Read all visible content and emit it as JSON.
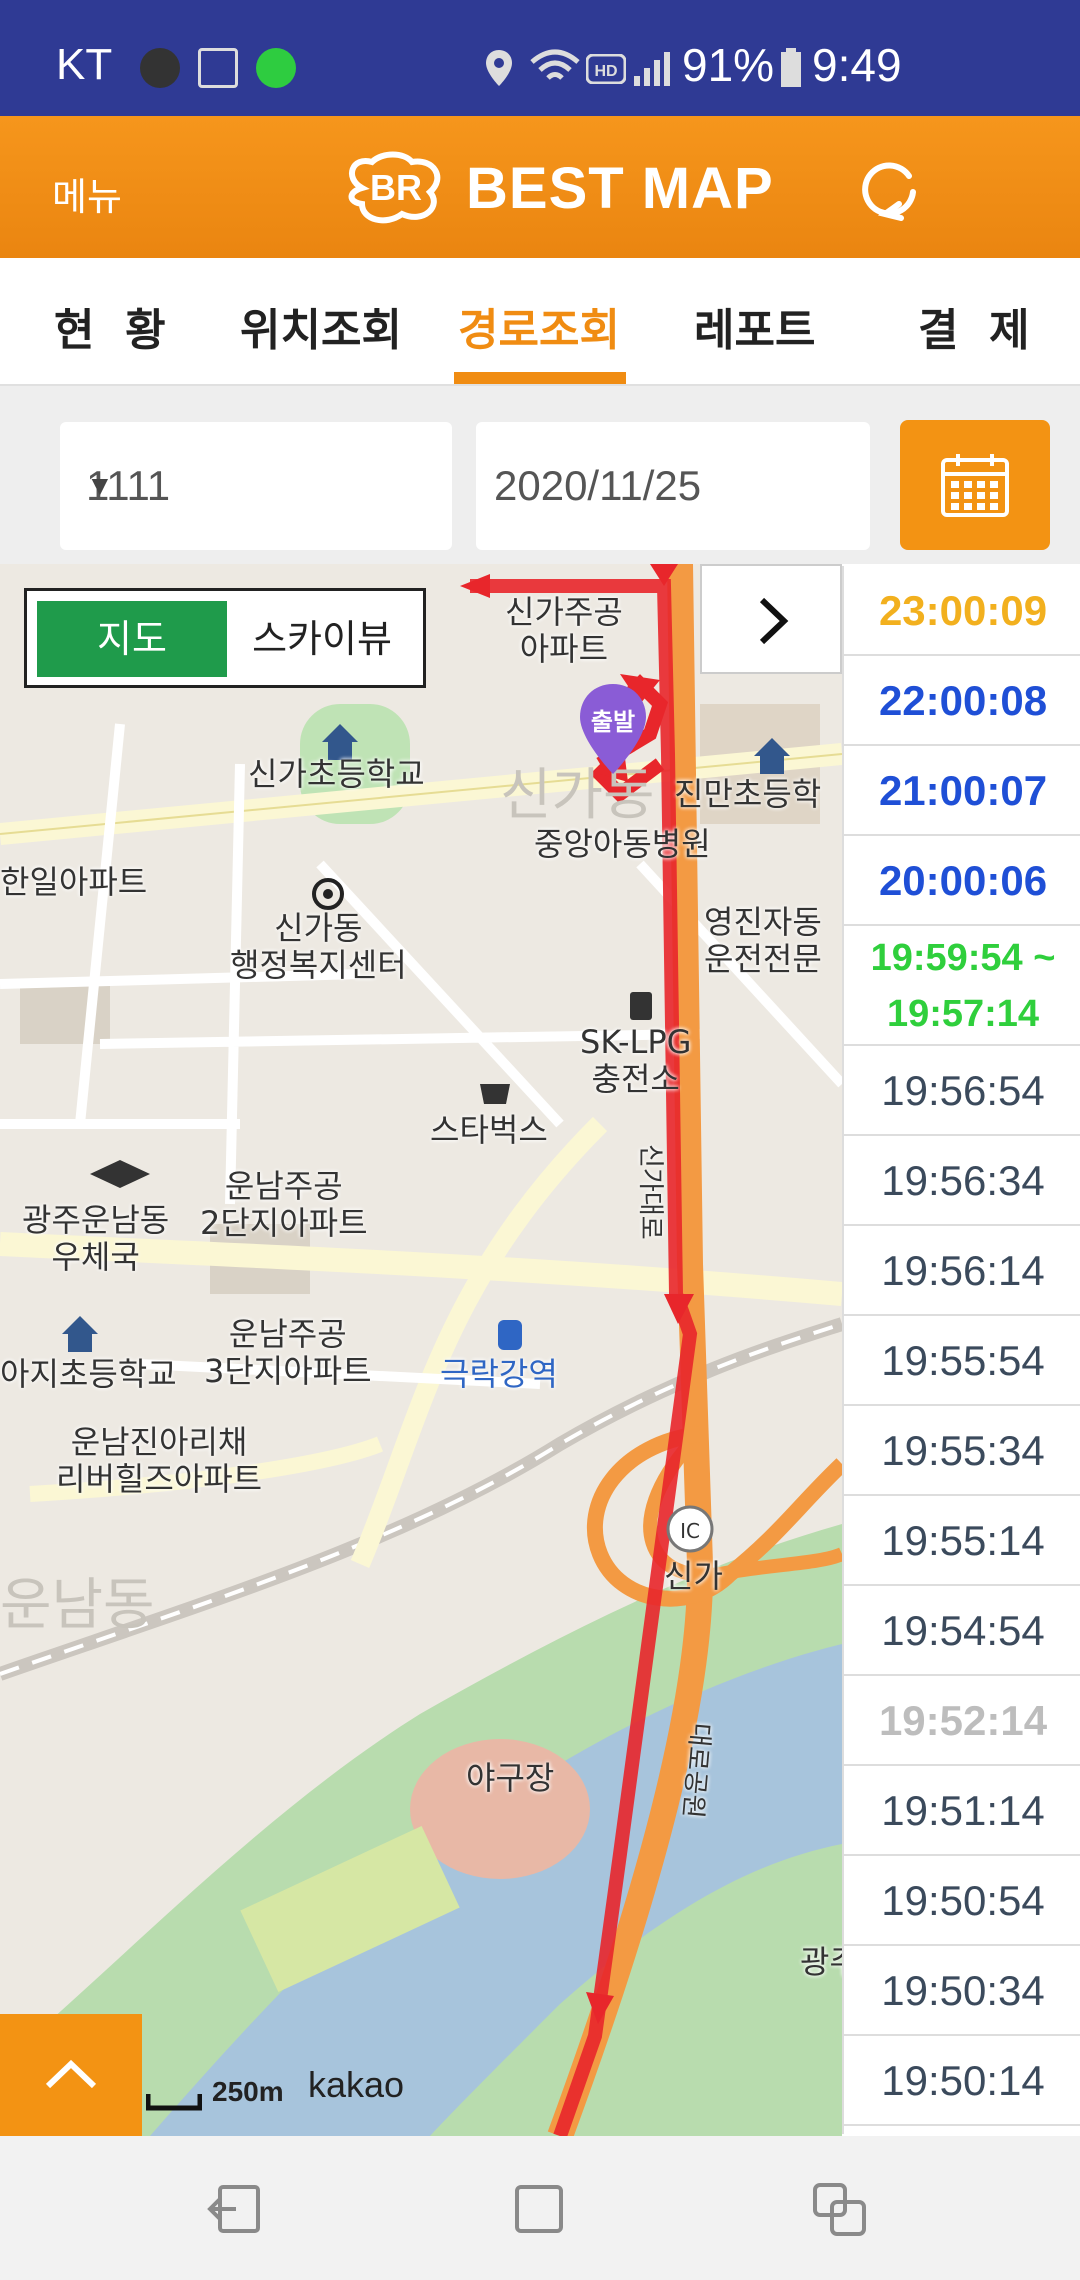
{
  "status_bar": {
    "carrier": "KT",
    "battery": "91%",
    "time": "9:49"
  },
  "header": {
    "menu_label": "메뉴",
    "logo_text": "BEST MAP"
  },
  "tabs": [
    {
      "label": "현  황",
      "active": false
    },
    {
      "label": "위치조회",
      "active": false
    },
    {
      "label": "경로조회",
      "active": true
    },
    {
      "label": "레포트",
      "active": false
    },
    {
      "label": "결  제",
      "active": false
    }
  ],
  "filters": {
    "vehicle_value": "1111",
    "date_value": "2020/11/25"
  },
  "map": {
    "toggle_map": "지도",
    "toggle_skyview": "스카이뷰",
    "start_marker": "출발",
    "scale_label": "250m",
    "provider": "kakao",
    "labels": {
      "apt_singa": "신가주공\n아파트",
      "school_singa": "신가초등학교",
      "school_jinman": "진만초등학",
      "hospital": "중앙아동병원",
      "welfare": "신가동\n행정복지센터",
      "apt_hanil": "한일아파트",
      "driving": "영진자동\n운전전문",
      "lpg": "SK-LPG\n충전소",
      "starbucks": "스타벅스",
      "post": "광주운남동\n우체국",
      "apt_unnam2": "운남주공\n2단지아파트",
      "apt_unnam3": "운남주공\n3단지아파트",
      "school_ji": "아지초등학교",
      "station": "극락강역",
      "apt_river": "운남진아리채\n리버힐즈아파트",
      "dong_unnam": "운남동",
      "dong_singa": "신가동",
      "ic": "신가",
      "ballpark": "야구장",
      "road_singa": "신가대로",
      "road_river": "대로공원",
      "gwang": "광주"
    }
  },
  "times": [
    {
      "label": "23:00:09",
      "color": "#f2b01e",
      "bold": true
    },
    {
      "label": "22:00:08",
      "color": "#1f4fd6",
      "bold": true
    },
    {
      "label": "21:00:07",
      "color": "#1f4fd6",
      "bold": true
    },
    {
      "label": "20:00:06",
      "color": "#1f4fd6",
      "bold": true
    },
    {
      "label": "19:56:54",
      "color": "#3b4a5c",
      "bold": false
    },
    {
      "label": "19:56:34",
      "color": "#3b4a5c",
      "bold": false
    },
    {
      "label": "19:56:14",
      "color": "#3b4a5c",
      "bold": false
    },
    {
      "label": "19:55:54",
      "color": "#3b4a5c",
      "bold": false
    },
    {
      "label": "19:55:34",
      "color": "#3b4a5c",
      "bold": false
    },
    {
      "label": "19:55:14",
      "color": "#3b4a5c",
      "bold": false
    },
    {
      "label": "19:54:54",
      "color": "#3b4a5c",
      "bold": false
    },
    {
      "label": "19:52:14",
      "color": "#bdbdbd",
      "bold": true
    },
    {
      "label": "19:51:14",
      "color": "#3b4a5c",
      "bold": false
    },
    {
      "label": "19:50:54",
      "color": "#3b4a5c",
      "bold": false
    },
    {
      "label": "19:50:34",
      "color": "#3b4a5c",
      "bold": false
    },
    {
      "label": "19:50:14",
      "color": "#3b4a5c",
      "bold": false
    }
  ],
  "time_range": {
    "line1": "19:59:54 ~",
    "line2": "19:57:14"
  },
  "colors": {
    "brand_orange": "#f39313",
    "status_bar": "#2f3a94",
    "route_red": "#e8262b",
    "road_orange": "#f39a43"
  }
}
